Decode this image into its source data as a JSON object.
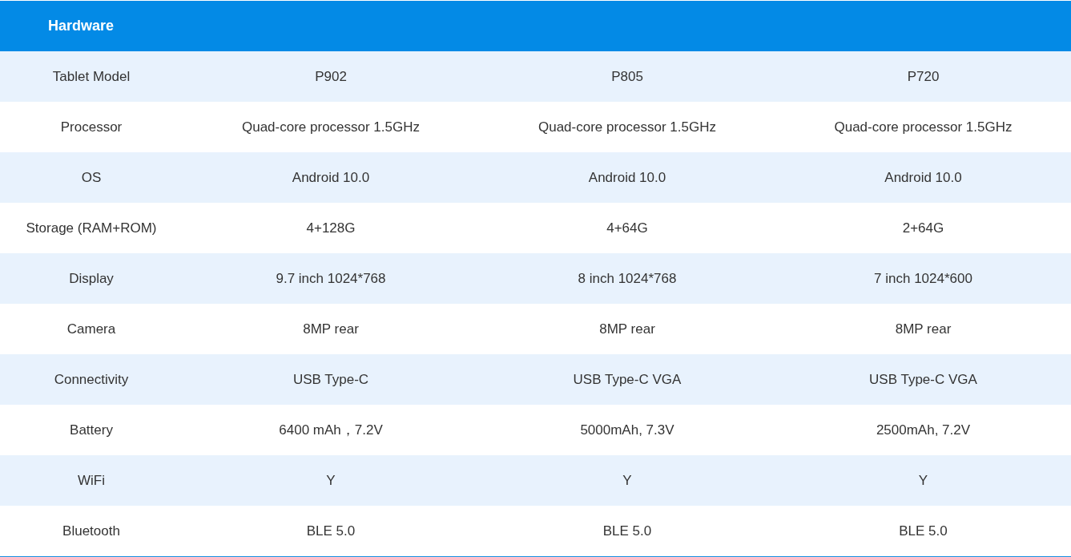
{
  "table": {
    "title": "Hardware",
    "rows": [
      {
        "label": "Tablet Model",
        "values": [
          "P902",
          "P805",
          "P720"
        ]
      },
      {
        "label": "Processor",
        "values": [
          "Quad-core processor 1.5GHz",
          "Quad-core processor 1.5GHz",
          "Quad-core processor 1.5GHz"
        ]
      },
      {
        "label": "OS",
        "values": [
          "Android 10.0",
          "Android 10.0",
          "Android 10.0"
        ]
      },
      {
        "label": "Storage (RAM+ROM)",
        "values": [
          "4+128G",
          "4+64G",
          "2+64G"
        ]
      },
      {
        "label": "Display",
        "values": [
          "9.7 inch 1024*768",
          "8 inch 1024*768",
          "7 inch 1024*600"
        ]
      },
      {
        "label": "Camera",
        "values": [
          "8MP rear",
          "8MP rear",
          "8MP rear"
        ]
      },
      {
        "label": "Connectivity",
        "values": [
          "USB Type-C",
          "USB Type-C VGA",
          "USB Type-C VGA"
        ]
      },
      {
        "label": "Battery",
        "values": [
          "6400 mAh，7.2V",
          "5000mAh, 7.3V",
          "2500mAh, 7.2V"
        ]
      },
      {
        "label": "WiFi",
        "values": [
          "Y",
          "Y",
          "Y"
        ]
      },
      {
        "label": "Bluetooth",
        "values": [
          "BLE 5.0",
          "BLE 5.0",
          "BLE 5.0"
        ]
      }
    ]
  }
}
